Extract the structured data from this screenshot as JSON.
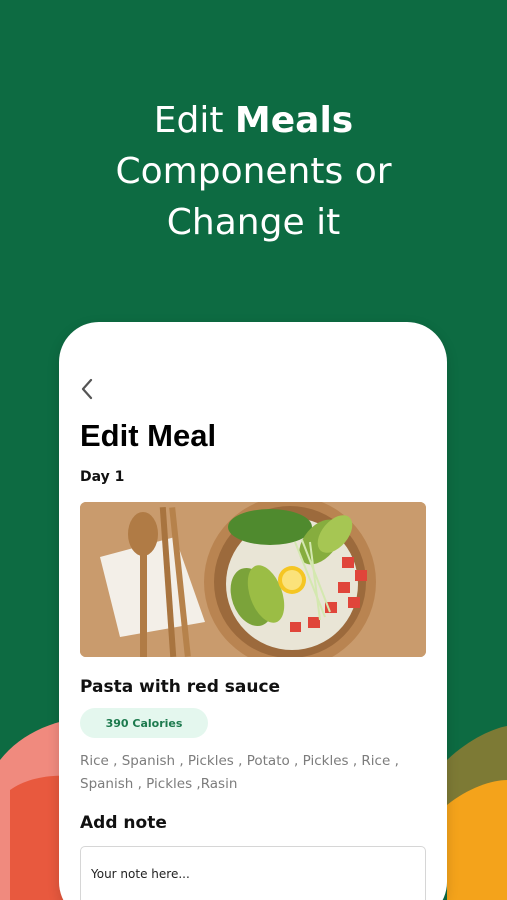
{
  "promo": {
    "line1_regular": "Edit ",
    "line1_bold": "Meals",
    "line2": "Components or",
    "line3": "Change it"
  },
  "screen": {
    "back_icon": "chevron-left-icon",
    "title": "Edit Meal",
    "day": "Day 1",
    "meal_name": "Pasta with red sauce",
    "calories": "390 Calories",
    "ingredients_line1": "Rice , Spanish , Pickles , Potato , Pickles , Rice ,",
    "ingredients_line2": "Spanish , Pickles ,Rasin",
    "note_label": "Add note",
    "note_placeholder": "Your note here..."
  },
  "colors": {
    "background": "#0d6b42",
    "accent_text": "#1d7a4e",
    "badge_bg": "#e4f7ee",
    "deco_pink": "#f08a7e",
    "deco_orange": "#f4a31b",
    "deco_olive": "#7d7a35"
  }
}
